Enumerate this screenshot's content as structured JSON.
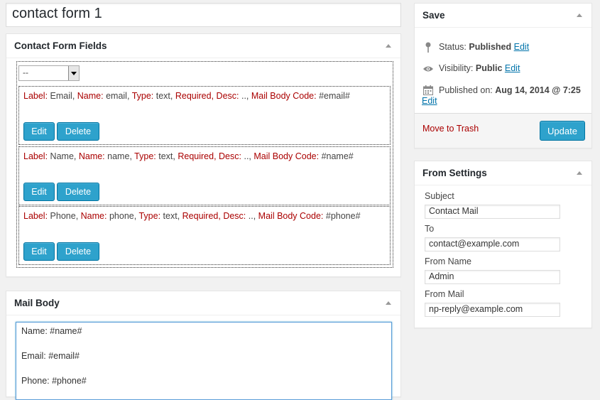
{
  "post_title": "contact form 1",
  "contact_fields_box": {
    "title": "Contact Form Fields",
    "field_select": "--",
    "fields": [
      {
        "label": "Email",
        "name": "email",
        "type": "text",
        "mail_code": "#email#"
      },
      {
        "label": "Name",
        "name": "name",
        "type": "text",
        "mail_code": "#name#"
      },
      {
        "label": "Phone",
        "name": "phone",
        "type": "text",
        "mail_code": "#phone#"
      }
    ],
    "keys": {
      "label": "Label:",
      "name": "Name:",
      "type": "Type:",
      "required": "Required,",
      "desc": "Desc:",
      "desc_val": "..,",
      "mail_body_code": "Mail Body Code:"
    },
    "edit_label": "Edit",
    "delete_label": "Delete"
  },
  "mail_body_box": {
    "title": "Mail Body",
    "lines": [
      "Name: #name#",
      "Email: #email#",
      "Phone: #phone#"
    ]
  },
  "save_box": {
    "title": "Save",
    "status_label": "Status:",
    "status_value": "Published",
    "visibility_label": "Visibility:",
    "visibility_value": "Public",
    "published_label": "Published on:",
    "published_value": "Aug 14, 2014 @ 7:25",
    "edit_link": "Edit",
    "trash_label": "Move to Trash",
    "update_label": "Update"
  },
  "from_settings_box": {
    "title": "From Settings",
    "subject_label": "Subject",
    "subject_value": "Contact Mail",
    "to_label": "To",
    "to_value": "contact@example.com",
    "from_name_label": "From Name",
    "from_name_value": "Admin",
    "from_mail_label": "From Mail",
    "from_mail_value": "np-reply@example.com"
  },
  "colors": {
    "primary_button": "#2ea2cc",
    "link": "#0073aa",
    "key_red": "#aa0000",
    "trash_red": "#aa0000"
  }
}
